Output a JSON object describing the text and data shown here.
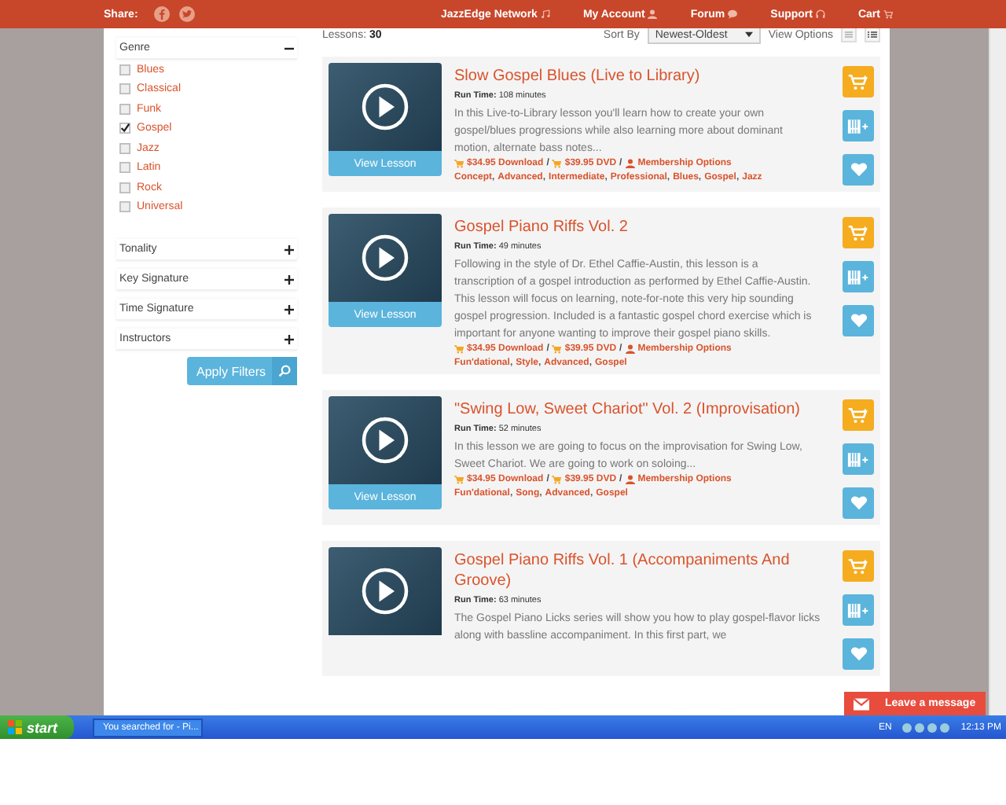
{
  "topbar": {
    "share_label": "Share:",
    "nav": [
      {
        "label": "JazzEdge Network"
      },
      {
        "label": "My Account"
      },
      {
        "label": "Forum"
      },
      {
        "label": "Support"
      },
      {
        "label": "Cart"
      }
    ]
  },
  "sidebar": {
    "genre": {
      "label": "Genre",
      "expanded": true,
      "items": [
        {
          "label": "Blues",
          "checked": false
        },
        {
          "label": "Classical",
          "checked": false
        },
        {
          "label": "Funk",
          "checked": false
        },
        {
          "label": "Gospel",
          "checked": true
        },
        {
          "label": "Jazz",
          "checked": false
        },
        {
          "label": "Latin",
          "checked": false
        },
        {
          "label": "Rock",
          "checked": false
        },
        {
          "label": "Universal",
          "checked": false
        }
      ]
    },
    "filters": [
      {
        "label": "Tonality",
        "expanded": false
      },
      {
        "label": "Key Signature",
        "expanded": false
      },
      {
        "label": "Time Signature",
        "expanded": false
      },
      {
        "label": "Instructors",
        "expanded": false
      }
    ],
    "apply_button": "Apply Filters"
  },
  "toolbar": {
    "lessons_label": "Lessons:",
    "lessons_count": "30",
    "sort_label": "Sort By",
    "sort_value": "Newest-Oldest",
    "view_label": "View Options"
  },
  "lessons": [
    {
      "title": "Slow Gospel Blues (Live to Library)",
      "runtime_label": "Run Time:",
      "runtime": "108 minutes",
      "description": "In this Live-to-Library lesson you'll learn how to create your own gospel/blues progressions while also learning more about dominant motion, alternate bass notes...",
      "download": "$34.95 Download",
      "dvd": "$39.95 DVD",
      "membership": "Membership Options",
      "price_separator": "/",
      "tag_separator": ",",
      "tags": [
        "Concept",
        "Advanced",
        "Intermediate",
        "Professional",
        "Blues",
        "Gospel",
        "Jazz"
      ],
      "button": "View Lesson"
    },
    {
      "title": "Gospel Piano Riffs Vol. 2",
      "runtime_label": "Run Time:",
      "runtime": "49 minutes",
      "description": "Following in the style of Dr. Ethel Caffie-Austin, this lesson is a transcription of a gospel introduction as performed by Ethel Caffie-Austin. This lesson will focus on learning, note-for-note this very hip sounding gospel progression. Included is a fantastic gospel chord exercise which is important for anyone wanting to improve their gospel piano skills.",
      "download": "$34.95 Download",
      "dvd": "$39.95 DVD",
      "membership": "Membership Options",
      "price_separator": "/",
      "tag_separator": ",",
      "tags": [
        "Fun'dational",
        "Style",
        "Advanced",
        "Gospel"
      ],
      "button": "View Lesson"
    },
    {
      "title": "\"Swing Low, Sweet Chariot\" Vol. 2 (Improvisation)",
      "runtime_label": "Run Time:",
      "runtime": "52 minutes",
      "description": "In this lesson we are going to focus on the improvisation for Swing Low, Sweet Chariot. We are going to work on soloing...",
      "download": "$34.95 Download",
      "dvd": "$39.95 DVD",
      "membership": "Membership Options",
      "price_separator": "/",
      "tag_separator": ",",
      "tags": [
        "Fun'dational",
        "Song",
        "Advanced",
        "Gospel"
      ],
      "button": "View Lesson"
    },
    {
      "title": "Gospel Piano Riffs Vol. 1 (Accompaniments And Groove)",
      "runtime_label": "Run Time:",
      "runtime": "63 minutes",
      "description": "The Gospel Piano Licks series will show you how to play gospel-flavor licks along with bassline accompaniment. In this first part, we"
    }
  ],
  "chat_button": "Leave a message",
  "taskbar": {
    "start": "start",
    "task": "You searched for - Pi...",
    "language": "EN",
    "clock": "12:13 PM"
  }
}
